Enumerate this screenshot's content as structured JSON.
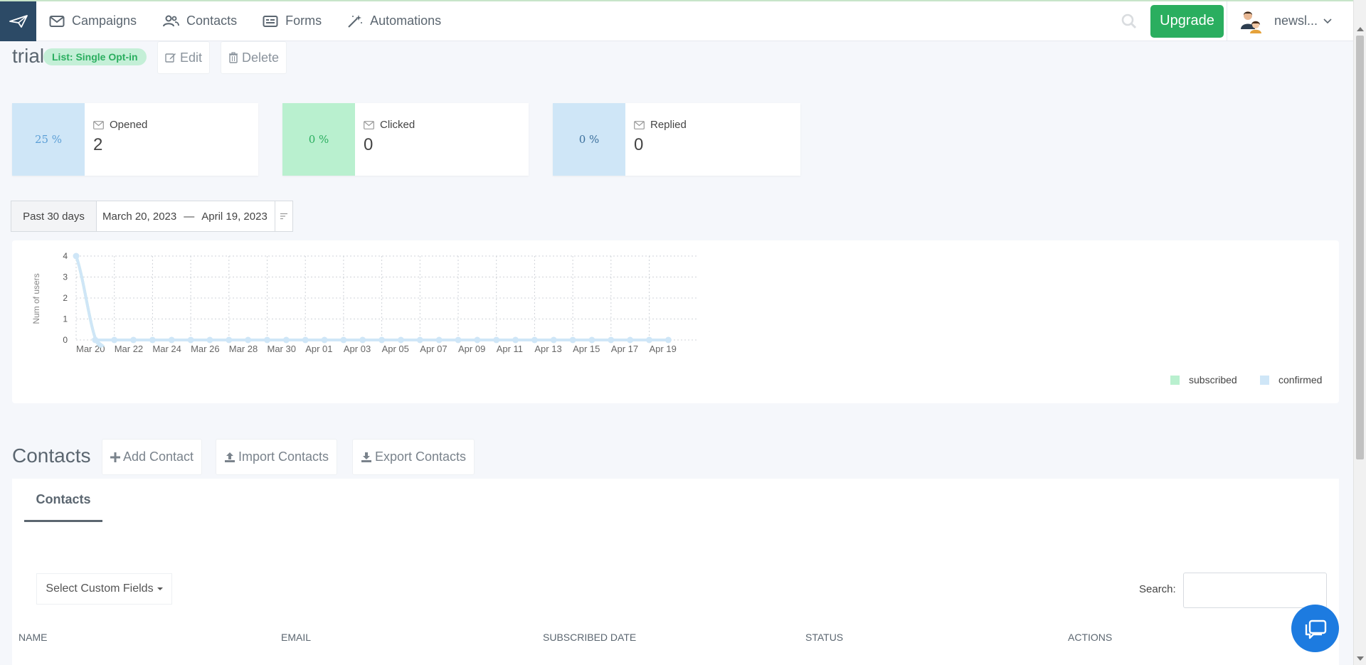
{
  "nav": {
    "items": [
      {
        "label": "Campaigns",
        "icon": "envelope-icon"
      },
      {
        "label": "Contacts",
        "icon": "users-icon"
      },
      {
        "label": "Forms",
        "icon": "form-icon"
      },
      {
        "label": "Automations",
        "icon": "magic-wand-icon"
      }
    ],
    "upgrade_label": "Upgrade",
    "user_name": "newsl..."
  },
  "list": {
    "title": "trial",
    "badge": "List: Single Opt-in",
    "edit_label": "Edit",
    "delete_label": "Delete"
  },
  "stats": [
    {
      "percent": "25 %",
      "label": "Opened",
      "value": "2",
      "color": "#cfe6f7",
      "text_color": "#5c9fd6"
    },
    {
      "percent": "0 %",
      "label": "Clicked",
      "value": "0",
      "color": "#b9f0cf",
      "text_color": "#2aae5f"
    },
    {
      "percent": "0 %",
      "label": "Replied",
      "value": "0",
      "color": "#cfe6f7",
      "text_color": "#3b6f9c"
    }
  ],
  "daterange": {
    "preset": "Past 30 days",
    "start": "March 20, 2023",
    "separator": "—",
    "end": "April 19, 2023"
  },
  "chart_data": {
    "type": "line",
    "title": "",
    "xlabel": "",
    "ylabel": "Num of users",
    "ylim": [
      0,
      4
    ],
    "yticks": [
      0,
      1,
      2,
      3,
      4
    ],
    "xtick_labels": [
      "Mar 20",
      "Mar 22",
      "Mar 24",
      "Mar 26",
      "Mar 28",
      "Mar 30",
      "Apr 01",
      "Apr 03",
      "Apr 05",
      "Apr 07",
      "Apr 09",
      "Apr 11",
      "Apr 13",
      "Apr 15",
      "Apr 17",
      "Apr 19"
    ],
    "x": [
      "Mar 20",
      "Mar 21",
      "Mar 22",
      "Mar 23",
      "Mar 24",
      "Mar 25",
      "Mar 26",
      "Mar 27",
      "Mar 28",
      "Mar 29",
      "Mar 30",
      "Mar 31",
      "Apr 01",
      "Apr 02",
      "Apr 03",
      "Apr 04",
      "Apr 05",
      "Apr 06",
      "Apr 07",
      "Apr 08",
      "Apr 09",
      "Apr 10",
      "Apr 11",
      "Apr 12",
      "Apr 13",
      "Apr 14",
      "Apr 15",
      "Apr 16",
      "Apr 17",
      "Apr 18",
      "Apr 19",
      "Apr 20"
    ],
    "series": [
      {
        "name": "subscribed",
        "color": "#b9f0cf",
        "values": [
          4,
          0,
          0,
          0,
          0,
          0,
          0,
          0,
          0,
          0,
          0,
          0,
          0,
          0,
          0,
          0,
          0,
          0,
          0,
          0,
          0,
          0,
          0,
          0,
          0,
          0,
          0,
          0,
          0,
          0,
          0,
          0
        ]
      },
      {
        "name": "confirmed",
        "color": "#cfe6f7",
        "values": [
          4,
          0,
          0,
          0,
          0,
          0,
          0,
          0,
          0,
          0,
          0,
          0,
          0,
          0,
          0,
          0,
          0,
          0,
          0,
          0,
          0,
          0,
          0,
          0,
          0,
          0,
          0,
          0,
          0,
          0,
          0,
          0
        ]
      }
    ],
    "grid": true,
    "legend": "bottom-right"
  },
  "contacts": {
    "title": "Contacts",
    "add_label": "Add Contact",
    "import_label": "Import Contacts",
    "export_label": "Export Contacts",
    "tab_label": "Contacts",
    "custom_fields_label": "Select Custom Fields",
    "search_label": "Search:",
    "columns": [
      "NAME",
      "EMAIL",
      "SUBSCRIBED DATE",
      "STATUS",
      "ACTIONS"
    ]
  }
}
